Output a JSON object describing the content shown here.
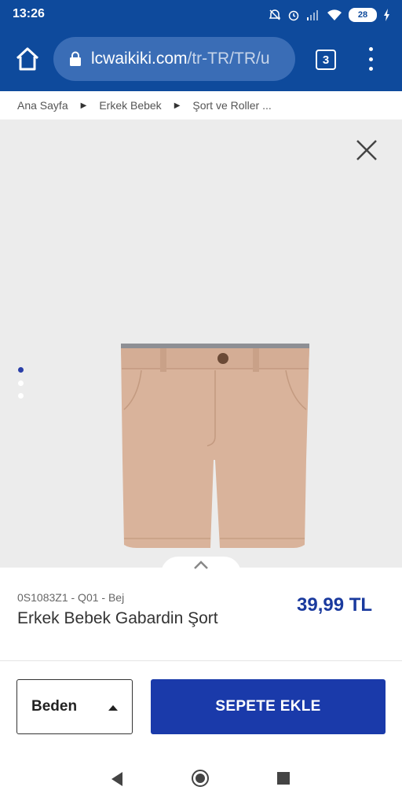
{
  "status_bar": {
    "time": "13:26",
    "battery": "28",
    "icons": [
      "alarm-off-icon",
      "alarm-clock-icon",
      "signal-icon",
      "wifi-icon",
      "battery-icon",
      "charging-icon"
    ]
  },
  "browser": {
    "url_host": "lcwaikiki.com",
    "url_path": "/tr-TR/TR/u",
    "tab_count": "3"
  },
  "breadcrumb": {
    "items": [
      "Ana Sayfa",
      "Erkek Bebek",
      "Şort ve Roller ..."
    ]
  },
  "product": {
    "sku": "0S1083Z1 - Q01 - Bej",
    "name": "Erkek Bebek Gabardin Şort",
    "price": "39,99 TL",
    "carousel": {
      "total": 3,
      "active": 1
    }
  },
  "actions": {
    "size_label": "Beden",
    "add_to_cart": "SEPETE EKLE"
  },
  "colors": {
    "header_blue": "#0e4a9c",
    "cta_blue": "#1a3aaa",
    "price_blue": "#1a3a9e",
    "image_bg": "#ececec"
  }
}
